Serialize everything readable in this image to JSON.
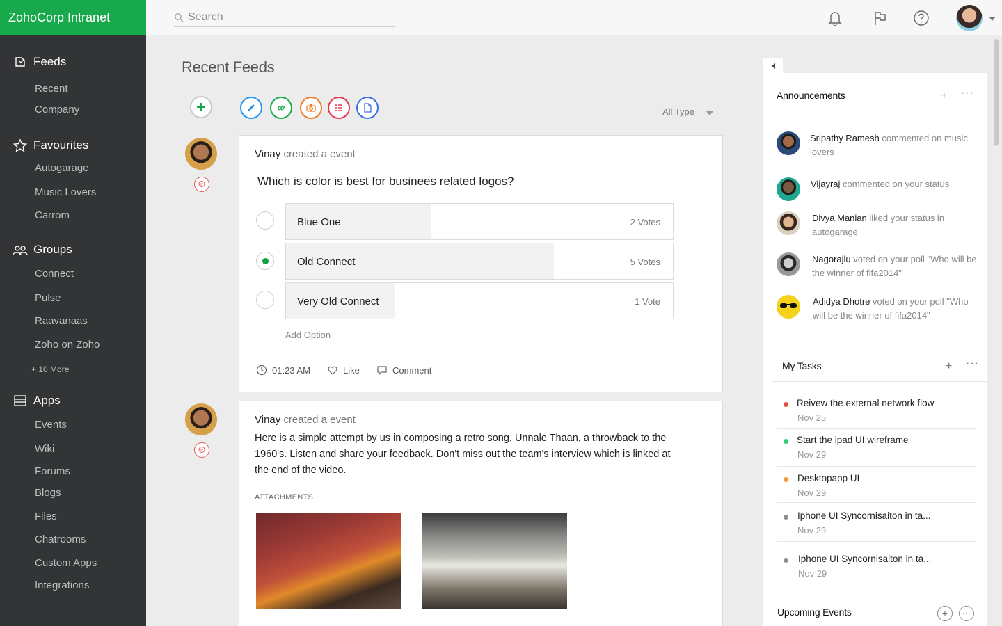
{
  "app": {
    "title": "ZohoCorp Intranet"
  },
  "search": {
    "placeholder": "Search"
  },
  "sidebar": {
    "feeds": {
      "label": "Feeds",
      "items": [
        "Recent",
        "Company"
      ]
    },
    "favourites": {
      "label": "Favourites",
      "items": [
        "Autogarage",
        "Music Lovers",
        "Carrom"
      ]
    },
    "groups": {
      "label": "Groups",
      "items": [
        "Connect",
        "Pulse",
        "Raavanaas",
        "Zoho on Zoho"
      ],
      "more": "+ 10 More"
    },
    "apps": {
      "label": "Apps",
      "items": [
        "Events",
        "Wiki",
        "Forums",
        "Blogs",
        "Files",
        "Chatrooms",
        "Custom Apps",
        "Integrations"
      ]
    }
  },
  "main": {
    "title": "Recent Feeds",
    "filter": "All Type",
    "post_types": [
      "edit-icon",
      "link-icon",
      "camera-icon",
      "list-icon",
      "document-icon"
    ],
    "colors": {
      "blue": "#2196f3",
      "green": "#17a94b",
      "orange": "#f07a22",
      "red": "#e8364d",
      "indigo": "#3a6fe6"
    }
  },
  "feeds": [
    {
      "author": "Vinay",
      "action": "created a event",
      "question": "Which is color is best for businees related logos?",
      "options": [
        {
          "label": "Blue One",
          "votes": "2 Votes",
          "share": 0.375,
          "selected": false
        },
        {
          "label": "Old Connect",
          "votes": "5 Votes",
          "share": 0.693,
          "selected": true
        },
        {
          "label": "Very Old Connect",
          "votes": "1 Vote",
          "share": 0.282,
          "selected": false
        }
      ],
      "add_option": "Add Option",
      "time": "01:23 AM",
      "like": "Like",
      "comment": "Comment"
    },
    {
      "author": "Vinay",
      "action": "created a event",
      "text": "Here is a simple attempt by us in composing a retro song, Unnale Thaan, a throwback to the 1960's. Listen and share your feedback. Don't miss out the team's interview which is linked at the end of the video.",
      "attachments_label": "ATTACHMENTS"
    }
  ],
  "announcements": {
    "title": "Announcements",
    "items": [
      {
        "name": "Sripathy Ramesh",
        "text": "commented on music lovers"
      },
      {
        "name": "Vijayraj",
        "text": "commented on your status"
      },
      {
        "name": "Divya Manian",
        "text": "liked your status in autogarage"
      },
      {
        "name": "Nagorajlu",
        "text": "voted on your poll \"Who will be the winner of fifa2014\""
      },
      {
        "name": "Adidya Dhotre",
        "text": "voted on your poll \"Who will be the winner of fifa2014\""
      }
    ]
  },
  "tasks": {
    "title": "My Tasks",
    "items": [
      {
        "title": "Reivew the external network flow",
        "date": "Nov 25",
        "color": "#e84c3d"
      },
      {
        "title": "Start the ipad UI wireframe",
        "date": "Nov 29",
        "color": "#2ecc71"
      },
      {
        "title": "Desktopapp UI",
        "date": "Nov 29",
        "color": "#f39c33"
      },
      {
        "title": "Iphone UI Syncornisaiton in ta...",
        "date": "Nov 29",
        "color": "#8e8e8e"
      },
      {
        "title": "Iphone UI Syncornisaiton in ta...",
        "date": "Nov 29",
        "color": "#8e8e8e"
      }
    ]
  },
  "events": {
    "title": "Upcoming Events"
  }
}
